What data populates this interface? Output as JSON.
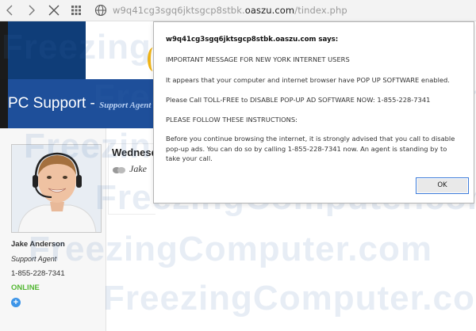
{
  "browser": {
    "address_subdomain": "w9q41cg3sgq6jktsgcp8stbk.",
    "address_domain": "oaszu.com",
    "address_path": "/tindex.php"
  },
  "site": {
    "brand_title": "PC Support -",
    "brand_subtitle": "Support Agent"
  },
  "agent": {
    "name": "Jake Anderson",
    "role": "Support Agent",
    "phone": "1-855-228-7341",
    "status": "ONLINE"
  },
  "content": {
    "day_title": "Wednesd",
    "chat_name": "Jake"
  },
  "dialog": {
    "title": "w9q41cg3sgq6jktsgcp8stbk.oaszu.com says:",
    "line1": "IMPORTANT MESSAGE FOR NEW YORK INTERNET USERS",
    "line2": "It appears that your computer and internet browser have POP UP SOFTWARE enabled.",
    "line3": "Please Call TOLL-FREE to DISABLE POP-UP AD SOFTWARE NOW: 1-855-228-7341",
    "line4": "PLEASE FOLLOW THESE INSTRUCTIONS:",
    "body": "Before you continue browsing the internet, it is strongly advised that you call to disable pop-up ads. You can do so by calling 1-855-228-7341 now. An agent is standing by to take your call.",
    "ok_label": "OK"
  },
  "watermark": {
    "line1": "FreezingComputer.com",
    "line2": "FreezingComputer.com",
    "line3": "FreezingComputer.com",
    "line4": "FreezingComputer.com",
    "line5": "FreezingComputer.com",
    "line6": "FreezingComputer.com"
  },
  "colors": {
    "header_blue": "#1e4f9a",
    "online_green": "#53b733",
    "ok_border": "#3b7ad9"
  }
}
